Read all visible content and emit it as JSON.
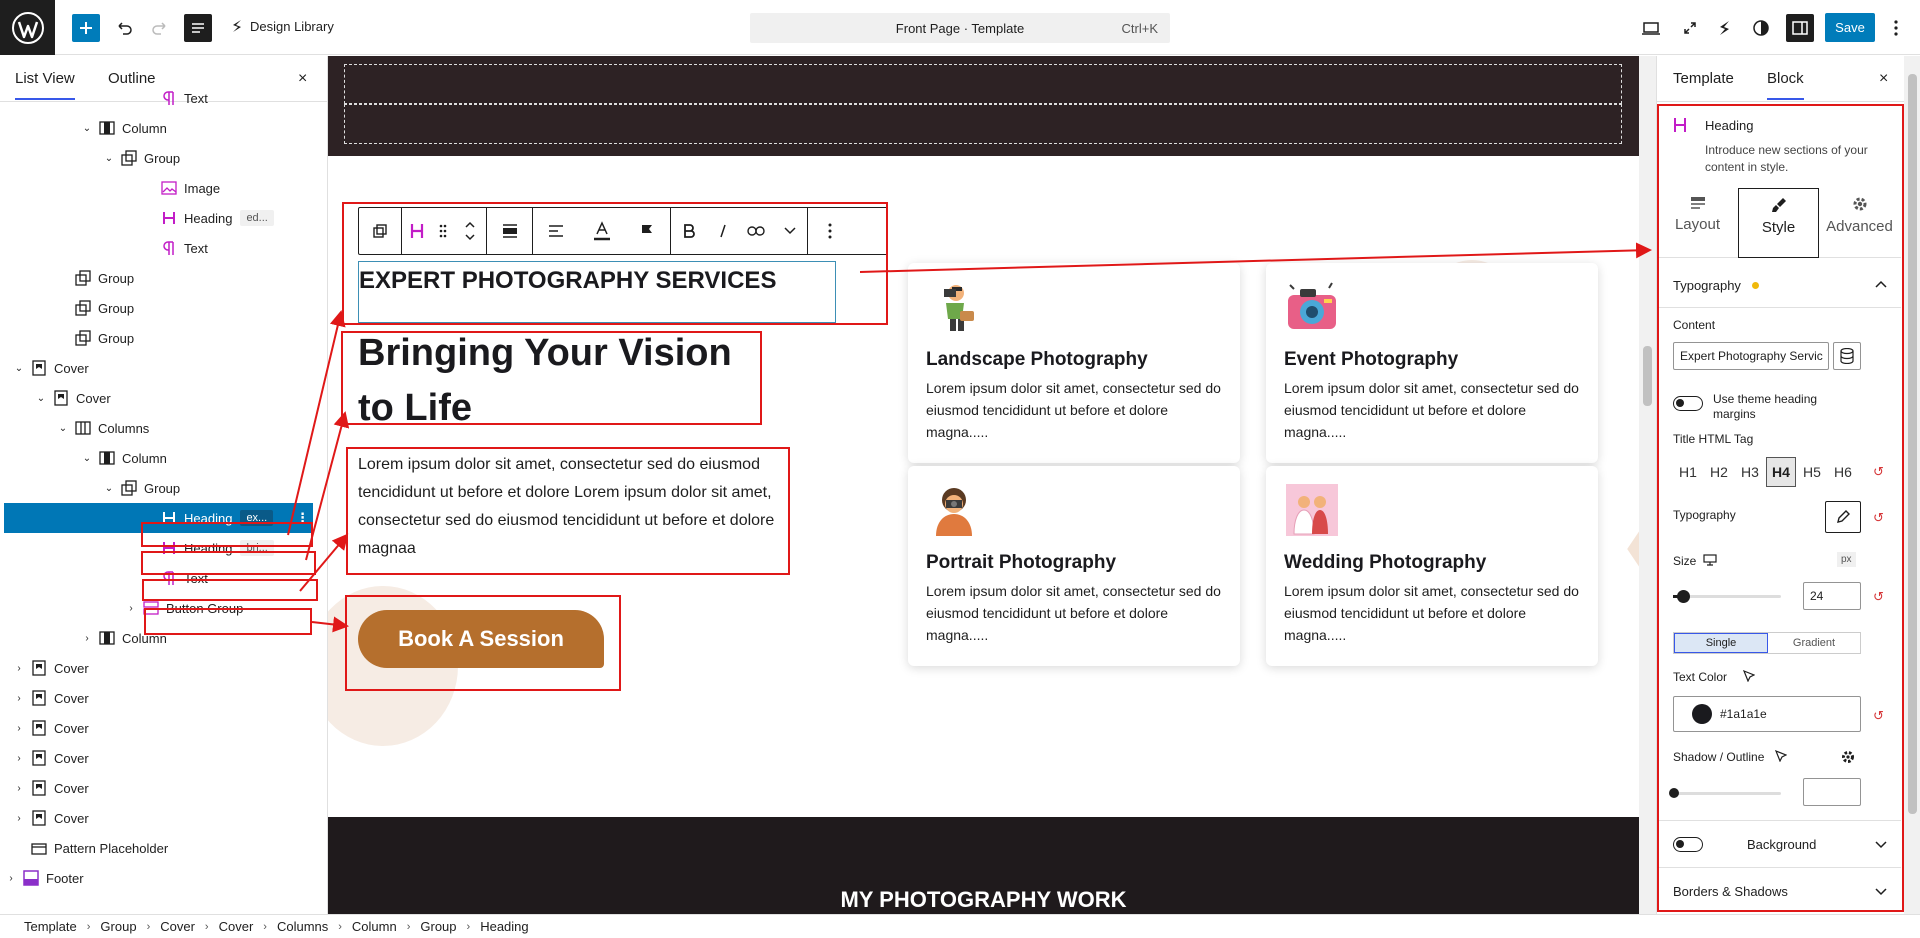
{
  "topbar": {
    "library_label": "Design Library",
    "command_title": "Front Page · Template",
    "command_shortcut": "Ctrl+K",
    "save_label": "Save"
  },
  "left_panel": {
    "tab_list": "List View",
    "tab_outline": "Outline",
    "close": "×",
    "items": [
      {
        "label": "Text",
        "icon": "paragraph-icon"
      },
      {
        "label": "Column",
        "icon": "column-icon"
      },
      {
        "label": "Group",
        "icon": "group-icon"
      },
      {
        "label": "Image",
        "icon": "image-icon"
      },
      {
        "label": "Heading",
        "badge": "ed...",
        "icon": "heading-icon"
      },
      {
        "label": "Text",
        "icon": "paragraph-icon"
      },
      {
        "label": "Group",
        "icon": "group-icon"
      },
      {
        "label": "Group",
        "icon": "group-icon"
      },
      {
        "label": "Group",
        "icon": "group-icon"
      },
      {
        "label": "Cover",
        "icon": "cover-icon"
      },
      {
        "label": "Cover",
        "icon": "cover-icon"
      },
      {
        "label": "Columns",
        "icon": "columns-icon"
      },
      {
        "label": "Column",
        "icon": "column-icon"
      },
      {
        "label": "Group",
        "icon": "group-icon"
      },
      {
        "label": "Heading",
        "badge": "ex...",
        "icon": "heading-icon",
        "selected": true
      },
      {
        "label": "Heading",
        "badge": "bri...",
        "icon": "heading-icon"
      },
      {
        "label": "Text",
        "icon": "paragraph-icon"
      },
      {
        "label": "Button Group",
        "icon": "button-group-icon"
      },
      {
        "label": "Column",
        "icon": "column-icon"
      },
      {
        "label": "Cover",
        "icon": "cover-icon"
      },
      {
        "label": "Cover",
        "icon": "cover-icon"
      },
      {
        "label": "Cover",
        "icon": "cover-icon"
      },
      {
        "label": "Cover",
        "icon": "cover-icon"
      },
      {
        "label": "Cover",
        "icon": "cover-icon"
      },
      {
        "label": "Cover",
        "icon": "cover-icon"
      },
      {
        "label": "Pattern Placeholder",
        "icon": "placeholder-icon"
      },
      {
        "label": "Footer",
        "icon": "footer-icon"
      }
    ]
  },
  "breadcrumb": [
    "Template",
    "Group",
    "Cover",
    "Cover",
    "Columns",
    "Column",
    "Group",
    "Heading"
  ],
  "canvas": {
    "eyebrow": "EXPERT PHOTOGRAPHY SERVICES",
    "headline": "Bringing Your Vision to Life",
    "paragraph": "Lorem ipsum dolor sit amet, consectetur sed do eiusmod tencididunt ut before et dolore Lorem ipsum dolor sit amet, consectetur sed do eiusmod tencididunt ut before et dolore magnaa",
    "button": "Book A Session",
    "cards": [
      {
        "title": "Landscape Photography",
        "desc": "Lorem ipsum dolor sit amet, consectetur sed do eiusmod tencididunt ut before et dolore magna.....",
        "icon": "photographer-icon"
      },
      {
        "title": "Event Photography",
        "desc": "Lorem ipsum dolor sit amet, consectetur sed do eiusmod tencididunt ut before et dolore magna.....",
        "icon": "camera-icon"
      },
      {
        "title": "Portrait Photography",
        "desc": "Lorem ipsum dolor sit amet, consectetur sed do eiusmod tencididunt ut before et dolore magna.....",
        "icon": "portrait-icon"
      },
      {
        "title": "Wedding Photography",
        "desc": "Lorem ipsum dolor sit amet, consectetur sed do eiusmod tencididunt ut before et dolore magna.....",
        "icon": "wedding-icon"
      }
    ],
    "bottom_title": "MY PHOTOGRAPHY WORK"
  },
  "right_panel": {
    "tab_template": "Template",
    "tab_block": "Block",
    "close": "×",
    "block_name": "Heading",
    "block_desc": "Introduce new sections of your content in style.",
    "tabs": [
      "Layout",
      "Style",
      "Advanced"
    ],
    "typography_section": "Typography",
    "content_label": "Content",
    "content_value": "Expert Photography Servic",
    "theme_margins": "Use theme heading margins",
    "html_tag_label": "Title HTML Tag",
    "html_tags": [
      "H1",
      "H2",
      "H3",
      "H4",
      "H5",
      "H6"
    ],
    "selected_tag": "H4",
    "typography_label": "Typography",
    "size_label": "Size",
    "size_unit": "px",
    "size_value": "24",
    "size_slider_fraction": 0.09,
    "single": "Single",
    "gradient": "Gradient",
    "text_color_label": "Text Color",
    "text_color": "#1a1a1e",
    "text_color_display": "#1a1a1e",
    "shadow_label": "Shadow / Outline",
    "background_label": "Background",
    "borders_label": "Borders & Shadows"
  },
  "colors": {
    "accent": "#007cba",
    "annotation_red": "#e01818",
    "button_brown": "#b56f2d",
    "dark_band": "#2d2224",
    "heading_icon": "#c21dc7"
  }
}
